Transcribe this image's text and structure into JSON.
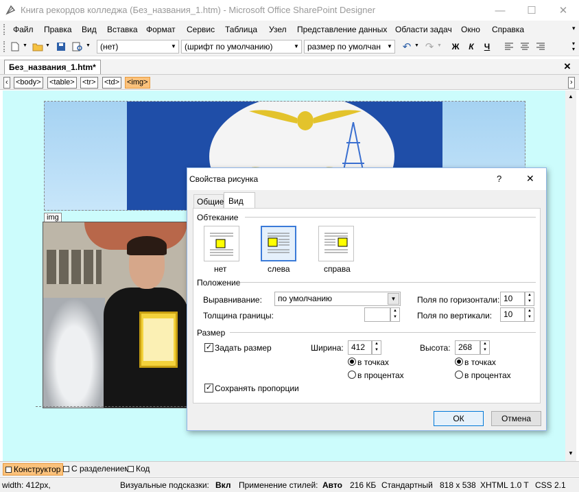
{
  "window": {
    "title": "Книга рекордов колледжа (Без_названия_1.htm) - Microsoft Office SharePoint Designer",
    "minimize": "—",
    "maximize": "☐",
    "close": "✕"
  },
  "menu": [
    "Файл",
    "Правка",
    "Вид",
    "Вставка",
    "Формат",
    "Сервис",
    "Таблица",
    "Узел",
    "Представление данных",
    "Области задач",
    "Окно",
    "Справка"
  ],
  "toolbar": {
    "style": "(нет)",
    "font": "(шрифт по умолчанию)",
    "size": "размер по умолчан",
    "bold": "Ж",
    "italic": "К",
    "underline": "Ч"
  },
  "doc_tab": {
    "label": "Без_названия_1.htm*",
    "close": "×"
  },
  "tag_bar": {
    "left": "‹",
    "right": "›",
    "tags": [
      "<body>",
      "<table>",
      "<tr>",
      "<td>",
      "<img>"
    ],
    "active": "<img>"
  },
  "canvas": {
    "img_label": "img",
    "banner_text": "ICNIS"
  },
  "bottom_tabs": [
    {
      "label": "Конструктор",
      "active": true
    },
    {
      "label": "С разделением",
      "active": false
    },
    {
      "label": "Код",
      "active": false
    }
  ],
  "status": {
    "width": "width: 412px,",
    "visual_aids_label": "Визуальные подсказки:",
    "visual_aids_value": "Вкл",
    "style_apply_label": "Применение стилей:",
    "style_apply_value": "Авто",
    "size": "216 КБ",
    "mode": "Стандартный",
    "dims": "818 x 538",
    "doctype": "XHTML 1.0 T",
    "css": "CSS 2.1"
  },
  "dialog": {
    "title": "Свойства рисунка",
    "help": "?",
    "close": "✕",
    "tabs": [
      "Общие",
      "Вид"
    ],
    "active_tab": "Вид",
    "wrapping": {
      "group": "Обтекание",
      "options": [
        "нет",
        "слева",
        "справа"
      ],
      "selected": "слева"
    },
    "layout": {
      "group": "Положение",
      "align_label": "Выравнивание:",
      "align_value": "по умолчанию",
      "border_label": "Толщина границы:",
      "border_value": "",
      "hspace_label": "Поля по горизонтали:",
      "hspace_value": "10",
      "vspace_label": "Поля по вертикали:",
      "vspace_value": "10"
    },
    "size": {
      "group": "Размер",
      "specify_label": "Задать размер",
      "specify_checked": true,
      "width_label": "Ширина:",
      "width_value": "412",
      "height_label": "Высота:",
      "height_value": "268",
      "in_pixels": "в точках",
      "in_percent": "в процентах",
      "keep_ratio_label": "Сохранять пропорции",
      "keep_ratio_checked": true
    },
    "ok": "ОК",
    "cancel": "Отмена"
  }
}
